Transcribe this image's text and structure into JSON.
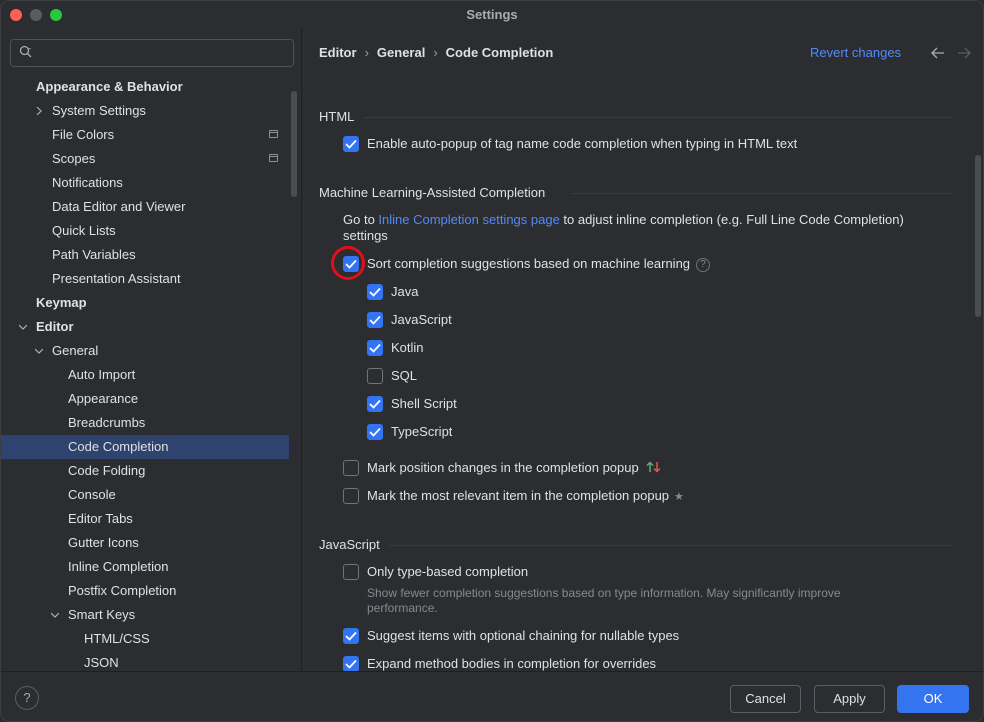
{
  "window": {
    "title": "Settings"
  },
  "search": {
    "placeholder": ""
  },
  "sidebar": {
    "items": [
      {
        "label": "Appearance & Behavior",
        "bold": true
      },
      {
        "label": "System Settings"
      },
      {
        "label": "File Colors"
      },
      {
        "label": "Scopes"
      },
      {
        "label": "Notifications"
      },
      {
        "label": "Data Editor and Viewer"
      },
      {
        "label": "Quick Lists"
      },
      {
        "label": "Path Variables"
      },
      {
        "label": "Presentation Assistant"
      },
      {
        "label": "Keymap",
        "bold": true
      },
      {
        "label": "Editor",
        "bold": true
      },
      {
        "label": "General"
      },
      {
        "label": "Auto Import"
      },
      {
        "label": "Appearance"
      },
      {
        "label": "Breadcrumbs"
      },
      {
        "label": "Code Completion",
        "selected": true
      },
      {
        "label": "Code Folding"
      },
      {
        "label": "Console"
      },
      {
        "label": "Editor Tabs"
      },
      {
        "label": "Gutter Icons"
      },
      {
        "label": "Inline Completion"
      },
      {
        "label": "Postfix Completion"
      },
      {
        "label": "Smart Keys"
      },
      {
        "label": "HTML/CSS"
      },
      {
        "label": "JSON"
      }
    ]
  },
  "breadcrumb": {
    "part1": "Editor",
    "part2": "General",
    "part3": "Code Completion",
    "sep": "›"
  },
  "header": {
    "revert": "Revert changes"
  },
  "html_section": {
    "title": "HTML",
    "autopopup": "Enable auto-popup of tag name code completion when typing in HTML text"
  },
  "ml_section": {
    "title": "Machine Learning-Assisted Completion",
    "goto_prefix": "Go to ",
    "goto_link": "Inline Completion settings page",
    "goto_suffix": " to adjust inline completion (e.g. Full Line Code Completion)",
    "goto_line2": "settings",
    "sort": "Sort completion suggestions based on machine learning",
    "langs": [
      "Java",
      "JavaScript",
      "Kotlin",
      "SQL",
      "Shell Script",
      "TypeScript"
    ],
    "mark_position": "Mark position changes in the completion popup",
    "mark_relevant": "Mark the most relevant item in the completion popup"
  },
  "js_section": {
    "title": "JavaScript",
    "type_based": "Only type-based completion",
    "type_based_desc1": "Show fewer completion suggestions based on type information. May significantly improve",
    "type_based_desc2": "performance.",
    "optional_chaining": "Suggest items with optional chaining for nullable types",
    "expand_bodies": "Expand method bodies in completion for overrides"
  },
  "footer": {
    "help": "?",
    "cancel": "Cancel",
    "apply": "Apply",
    "ok": "OK"
  },
  "colors": {
    "accent": "#3574f0",
    "link": "#548af7",
    "highlight_circle": "#e0101a"
  }
}
